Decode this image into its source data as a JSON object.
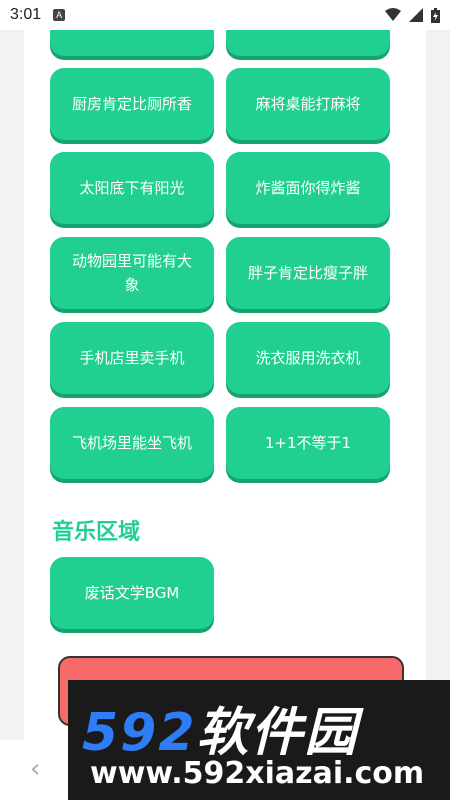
{
  "status_bar": {
    "time": "3:01",
    "notif_badge": "A"
  },
  "buttons": [
    {
      "label": ""
    },
    {
      "label": ""
    },
    {
      "label": "厨房肯定比厕所香"
    },
    {
      "label": "麻将桌能打麻将"
    },
    {
      "label": "太阳底下有阳光"
    },
    {
      "label": "炸酱面你得炸酱"
    },
    {
      "label": "动物园里可能有大象"
    },
    {
      "label": "胖子肯定比瘦子胖"
    },
    {
      "label": "手机店里卖手机"
    },
    {
      "label": "洗衣服用洗衣机"
    },
    {
      "label": "飞机场里能坐飞机"
    },
    {
      "label": "1+1不等于1"
    }
  ],
  "music_section": {
    "title": "音乐区域",
    "items": [
      {
        "label": "废话文学BGM"
      }
    ]
  },
  "watermark": {
    "brand_num": "592",
    "brand_cn": "软件园",
    "url": "www.592xiazai.com"
  },
  "colors": {
    "accent": "#21cf90",
    "accent_shadow": "#16a36e",
    "red": "#f76a6a"
  }
}
